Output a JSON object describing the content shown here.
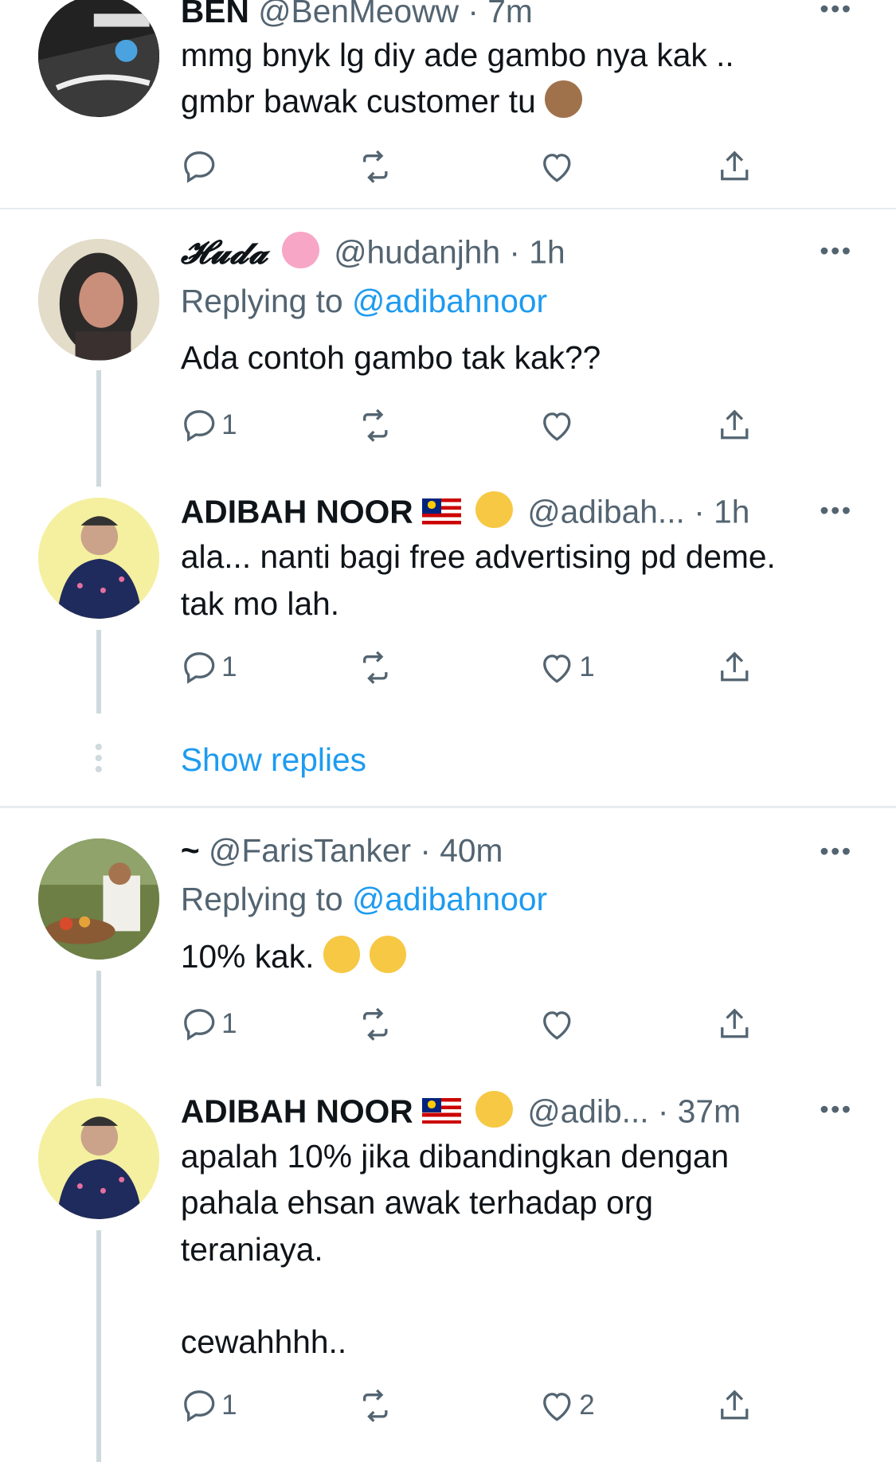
{
  "tweets": [
    {
      "name": "BEN",
      "handle": "@BenMeoww",
      "time": "· 7m",
      "text": "mmg bnyk lg diy ade gambo nya kak ..\ngmbr bawak customer tu",
      "emoji": "monkey-emoji",
      "reply_count": "",
      "like_count": ""
    },
    {
      "name": "𝓗𝓾𝓭𝓪",
      "handle": "@hudanjhh",
      "time": "· 1h",
      "replying_prefix": "Replying to",
      "replying_to": "@adibahnoor",
      "text": "Ada contoh gambo tak kak??",
      "reply_count": "1",
      "like_count": ""
    },
    {
      "name": "ADIBAH NOOR",
      "handle": "@adibah...",
      "time": "· 1h",
      "text": "ala... nanti bagi free advertising pd deme.\ntak mo lah.",
      "reply_count": "1",
      "like_count": "1"
    },
    {
      "name": "~",
      "handle": "@FarisTanker",
      "time": "· 40m",
      "replying_prefix": "Replying to",
      "replying_to": "@adibahnoor",
      "text": "10% kak.",
      "reply_count": "1",
      "like_count": ""
    },
    {
      "name": "ADIBAH NOOR",
      "handle": "@adib...",
      "time": "· 37m",
      "text": "apalah 10% jika dibandingkan dengan\npahala ehsan awak terhadap org\nteraniaya.\n\ncewahhhh..",
      "reply_count": "1",
      "like_count": "2"
    }
  ],
  "show_replies_label": "Show replies",
  "more_label": "•••",
  "colors": {
    "accent": "#1d9bf0",
    "muted": "#536471",
    "divider": "#e6ecf0",
    "thread": "#cfd9de"
  }
}
